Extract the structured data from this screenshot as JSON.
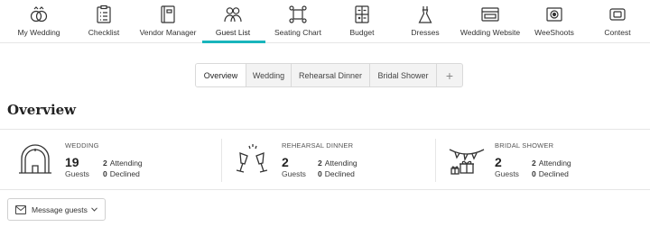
{
  "nav": {
    "items": [
      {
        "label": "My Wedding",
        "icon": "rings-icon"
      },
      {
        "label": "Checklist",
        "icon": "checklist-icon"
      },
      {
        "label": "Vendor Manager",
        "icon": "notebook-icon"
      },
      {
        "label": "Guest List",
        "icon": "guests-icon"
      },
      {
        "label": "Seating Chart",
        "icon": "seating-icon"
      },
      {
        "label": "Budget",
        "icon": "calculator-icon"
      },
      {
        "label": "Dresses",
        "icon": "dress-icon"
      },
      {
        "label": "Wedding Website",
        "icon": "browser-icon"
      },
      {
        "label": "WeeShoots",
        "icon": "camera-icon"
      },
      {
        "label": "Contest",
        "icon": "ticket-icon"
      }
    ],
    "active": "Guest List",
    "accent_color": "#19b5bc"
  },
  "tabs": {
    "items": [
      "Overview",
      "Wedding",
      "Rehearsal Dinner",
      "Bridal Shower"
    ],
    "selected": "Overview",
    "add_label": "+"
  },
  "overview": {
    "title": "Overview"
  },
  "events": [
    {
      "title": "WEDDING",
      "guests_count": "19",
      "guests_label": "Guests",
      "attending_count": "2",
      "attending_label": "Attending",
      "declined_count": "0",
      "declined_label": "Declined",
      "icon": "arch-icon"
    },
    {
      "title": "REHEARSAL DINNER",
      "guests_count": "2",
      "guests_label": "Guests",
      "attending_count": "2",
      "attending_label": "Attending",
      "declined_count": "0",
      "declined_label": "Declined",
      "icon": "champagne-glasses-icon"
    },
    {
      "title": "BRIDAL SHOWER",
      "guests_count": "2",
      "guests_label": "Guests",
      "attending_count": "2",
      "attending_label": "Attending",
      "declined_count": "0",
      "declined_label": "Declined",
      "icon": "gifts-bunting-icon"
    }
  ],
  "message_button": {
    "label": "Message guests",
    "icon": "envelope-icon"
  }
}
